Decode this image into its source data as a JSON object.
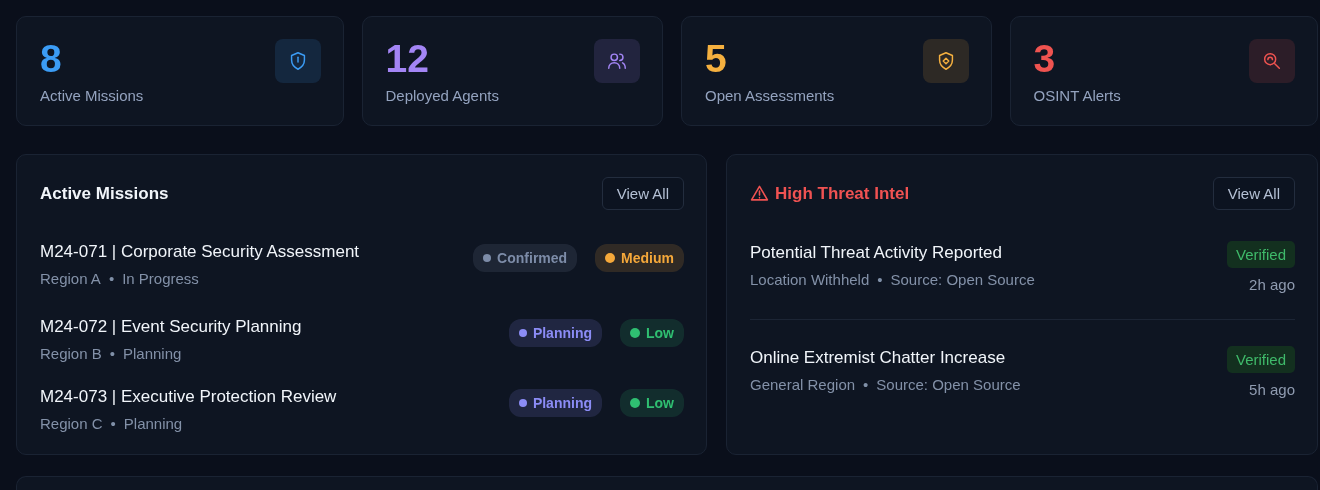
{
  "stats": [
    {
      "value": "8",
      "label": "Active Missions",
      "color": "#3b9cf5",
      "kind": "missions"
    },
    {
      "value": "12",
      "label": "Deployed Agents",
      "color": "#a385f5",
      "kind": "agents"
    },
    {
      "value": "5",
      "label": "Open Assessments",
      "color": "#f5b03f",
      "kind": "assessments"
    },
    {
      "value": "3",
      "label": "OSINT Alerts",
      "color": "#ef5350",
      "kind": "alerts"
    }
  ],
  "missions": {
    "title": "Active Missions",
    "button": "View All",
    "items": [
      {
        "title": "M24-071 | Corporate Security Assessment",
        "region": "Region A",
        "separator": "•",
        "state": "In Progress",
        "tags": [
          {
            "label": "Confirmed",
            "color": "#7d8ca8"
          },
          {
            "label": "Medium",
            "color": "#f5a83a"
          }
        ]
      },
      {
        "title": "M24-072 | Event Security Planning",
        "region": "Region B",
        "separator": "•",
        "state": "Planning",
        "tags": [
          {
            "label": "Planning",
            "color": "#8b8cf5"
          },
          {
            "label": "Low",
            "color": "#2fbf71"
          }
        ]
      },
      {
        "title": "M24-073 | Executive Protection Review",
        "region": "Region C",
        "separator": "•",
        "state": "Planning",
        "tags": [
          {
            "label": "Planning",
            "color": "#8b8cf5"
          },
          {
            "label": "Low",
            "color": "#2fbf71"
          }
        ]
      }
    ]
  },
  "intel": {
    "title": "High Threat Intel",
    "button": "View All",
    "items": [
      {
        "title": "Potential Threat Activity Reported",
        "location": "Location Withheld",
        "separator": "•",
        "source": "Source: Open Source",
        "badge": "Verified",
        "time": "2h ago"
      },
      {
        "title": "Online Extremist Chatter Increase",
        "location": "General Region",
        "separator": "•",
        "source": "Source: Open Source",
        "badge": "Verified",
        "time": "5h ago"
      }
    ]
  }
}
